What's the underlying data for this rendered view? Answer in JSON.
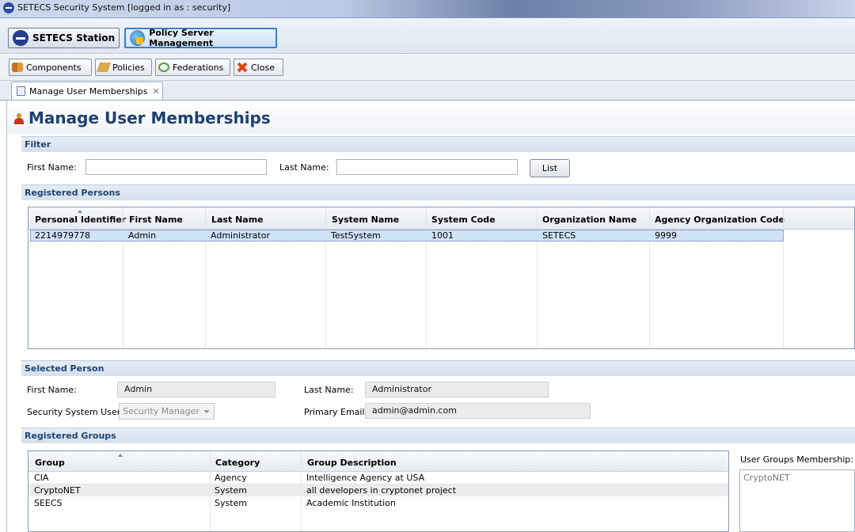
{
  "window": {
    "title": "SETECS Security System [logged in as : security]"
  },
  "stations": [
    {
      "label": "SETECS Station",
      "icon": "setecs-logo-icon"
    },
    {
      "label": "Policy Server Management",
      "icon": "globe-lock-icon"
    }
  ],
  "toolbar": {
    "components": "Components",
    "policies": "Policies",
    "federations": "Federations",
    "close": "Close"
  },
  "editor_tab": {
    "label": "Manage User Memberships"
  },
  "page": {
    "title": "Manage User Memberships"
  },
  "filter": {
    "section": "Filter",
    "first_name_label": "First Name:",
    "first_name_value": "",
    "last_name_label": "Last Name:",
    "last_name_value": "",
    "list_button": "List"
  },
  "registered_persons": {
    "section": "Registered Persons",
    "columns": [
      "Personal Identifier",
      "First Name",
      "Last Name",
      "System Name",
      "System Code",
      "Organization Name",
      "Agency Organization Code"
    ],
    "rows": [
      [
        "2214979778",
        "Admin",
        "Administrator",
        "TestSystem",
        "1001",
        "SETECS",
        "9999"
      ]
    ]
  },
  "selected_person": {
    "section": "Selected Person",
    "first_name_label": "First Name:",
    "first_name_value": "Admin",
    "last_name_label": "Last Name:",
    "last_name_value": "Administrator",
    "security_user_label": "Security System User:",
    "security_user_value": "Security Manager",
    "email_label": "Primary Email:",
    "email_value": "admin@admin.com"
  },
  "registered_groups": {
    "section": "Registered Groups",
    "columns": [
      "Group",
      "Category",
      "Group Description"
    ],
    "rows": [
      [
        "CIA",
        "Agency",
        "Intelligence Agency at USA"
      ],
      [
        "CryptoNET",
        "System",
        "all developers in cryptonet project"
      ],
      [
        "SEECS",
        "System",
        "Academic Institution"
      ]
    ],
    "membership_label": "User Groups Membership:",
    "membership_items": [
      "CryptoNET"
    ]
  },
  "colors": {
    "accent": "#3a7fd0",
    "heading": "#1e416e",
    "section_text": "#1f4473",
    "selection": "#cfe3f7"
  }
}
